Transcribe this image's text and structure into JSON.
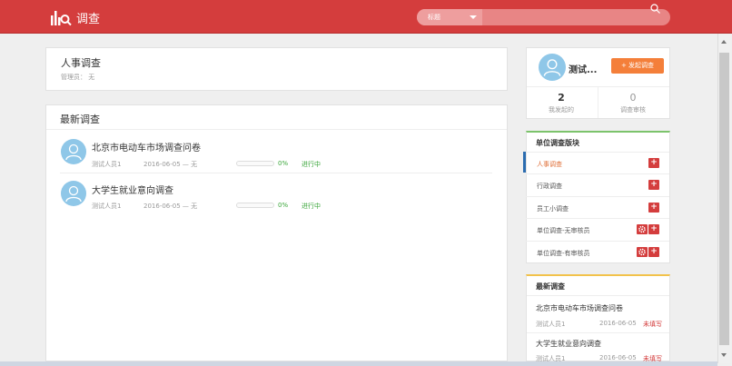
{
  "header": {
    "title": "调查",
    "search": {
      "select_value": "标题",
      "placeholder": ""
    }
  },
  "org_panel": {
    "title": "人事调查",
    "admin": "管理员： 无"
  },
  "recent_panel": {
    "title": "最新调查",
    "items": [
      {
        "title": "北京市电动车市场调查问卷",
        "author": "测试人员1",
        "date": "2016-06-05 — 无",
        "progress": "0%",
        "progress_value": 0,
        "status": "进行中"
      },
      {
        "title": "大学生就业意向调查",
        "author": "测试人员1",
        "date": "2016-06-05 — 无",
        "progress": "0%",
        "progress_value": 0,
        "status": "进行中"
      }
    ]
  },
  "user_card": {
    "name": "测试...",
    "start_button": "发起调查",
    "stats": [
      {
        "num": "2",
        "label": "我发起的"
      },
      {
        "num": "0",
        "label": "调查审核"
      }
    ]
  },
  "categories": {
    "title": "单位调查版块",
    "items": [
      {
        "label": "人事调查",
        "active": true
      },
      {
        "label": "行政调查"
      },
      {
        "label": "员工小调查"
      },
      {
        "label": "单位调查-无审核员",
        "gear": true
      },
      {
        "label": "单位调查-有审核员",
        "gear": true
      }
    ]
  },
  "latest": {
    "title": "最新调查",
    "items": [
      {
        "title": "北京市电动车市场调查问卷",
        "author": "测试人员1",
        "date": "2016-06-05",
        "state": "未填写"
      },
      {
        "title": "大学生就业意向调查",
        "author": "测试人员1",
        "date": "2016-06-05",
        "state": "未填写"
      }
    ]
  },
  "colors": {
    "header": "#d43d3d",
    "accent_orange": "#f47f3a",
    "status_green": "#3aa63a",
    "avatar_blue": "#8fc7e8"
  },
  "icons": [
    "chart-search-logo-icon",
    "chevron-down-icon",
    "search-icon",
    "user-avatar-icon",
    "plus-icon",
    "gear-icon"
  ]
}
